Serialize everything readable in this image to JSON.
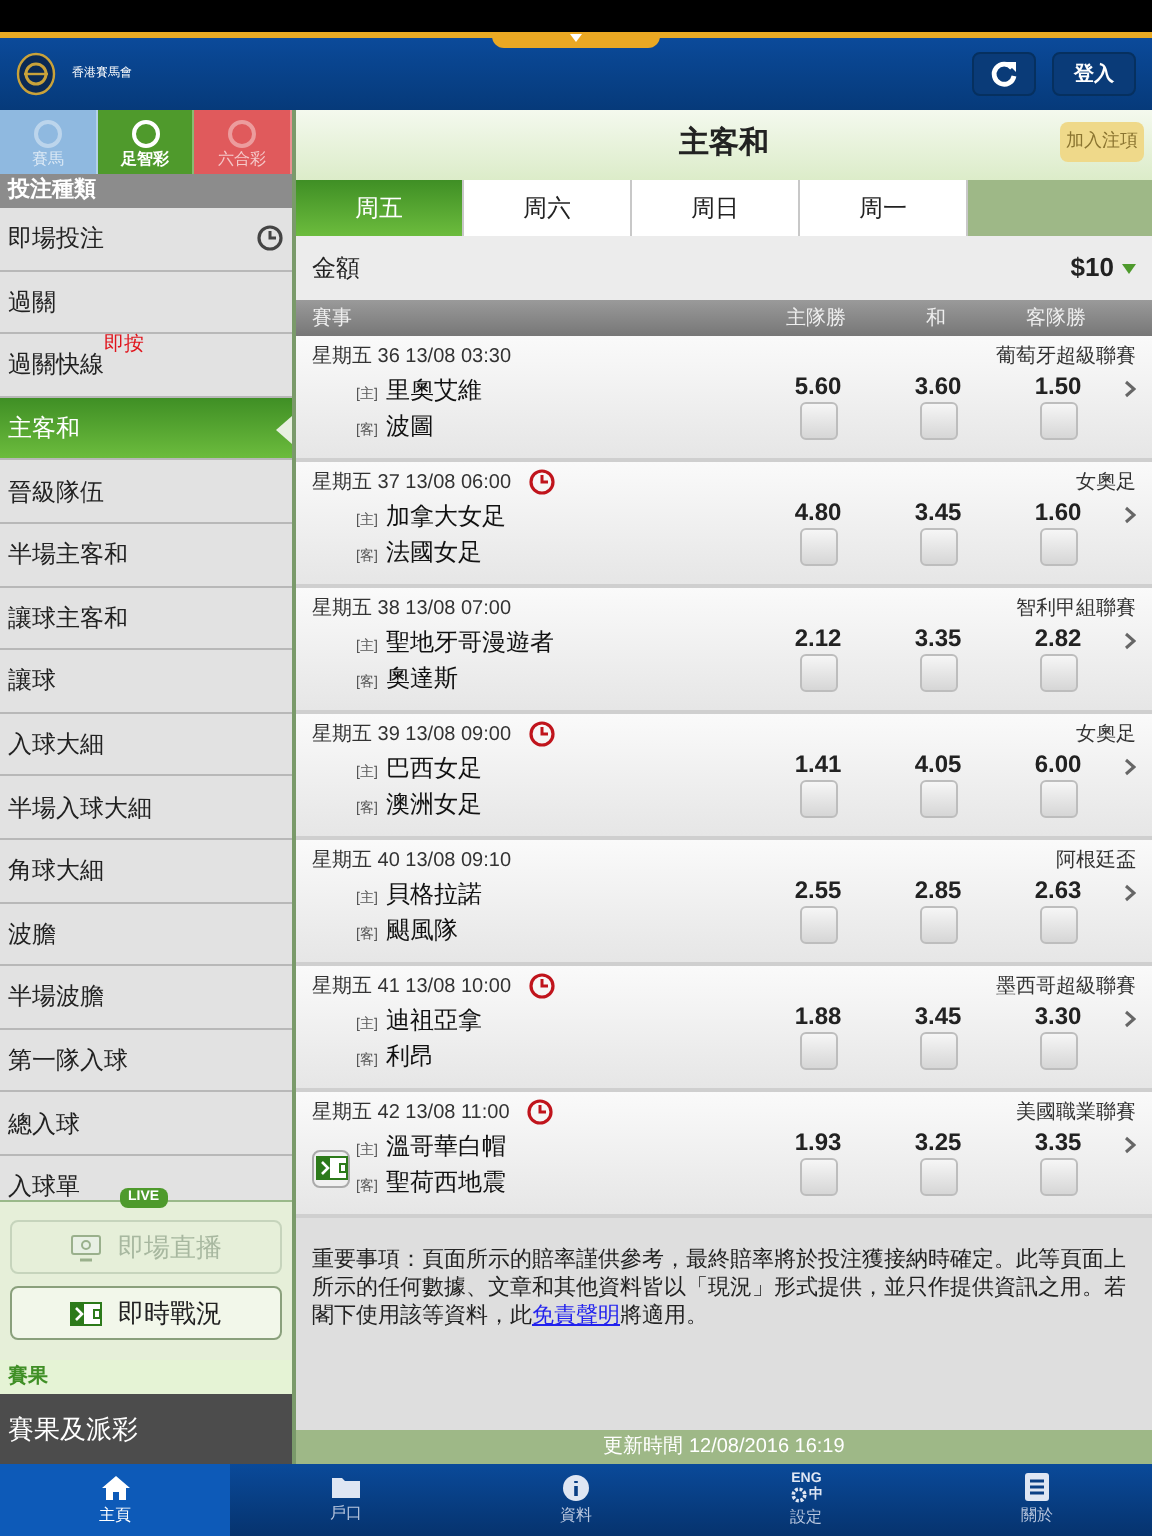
{
  "header": {
    "logo_text": "香港賽馬會",
    "login": "登入"
  },
  "sport_tabs": [
    {
      "label": "賽馬",
      "selected": false,
      "color": "#8fb9e0"
    },
    {
      "label": "足智彩",
      "selected": true,
      "color": "#4f9a2c"
    },
    {
      "label": "六合彩",
      "selected": false,
      "color": "#e05a5c"
    }
  ],
  "sidebar": {
    "heading": "投注種類",
    "items": [
      {
        "label": "即場投注",
        "selected": false,
        "kind": "clock"
      },
      {
        "label": "過關",
        "selected": false
      },
      {
        "label": "過關快線",
        "selected": false,
        "badge": "即按"
      },
      {
        "label": "主客和",
        "selected": true
      },
      {
        "label": "晉級隊伍",
        "selected": false
      },
      {
        "label": "半場主客和",
        "selected": false
      },
      {
        "label": "讓球主客和",
        "selected": false
      },
      {
        "label": "讓球",
        "selected": false
      },
      {
        "label": "入球大細",
        "selected": false
      },
      {
        "label": "半場入球大細",
        "selected": false
      },
      {
        "label": "角球大細",
        "selected": false
      },
      {
        "label": "波膽",
        "selected": false
      },
      {
        "label": "半場波膽",
        "selected": false
      },
      {
        "label": "第一隊入球",
        "selected": false
      },
      {
        "label": "總入球",
        "selected": false
      },
      {
        "label": "入球單",
        "selected": false
      }
    ],
    "live": {
      "tag": "LIVE",
      "buttons": [
        {
          "label": "即場直播",
          "disabled": true,
          "kind": "tv"
        },
        {
          "label": "即時戰況",
          "disabled": false,
          "kind": "pitch"
        }
      ]
    },
    "results_heading": "賽果",
    "results_item": "賽果及派彩"
  },
  "main": {
    "title": "主客和",
    "add_button": "加入注項",
    "day_tabs": [
      {
        "label": "周五",
        "selected": true
      },
      {
        "label": "周六",
        "selected": false
      },
      {
        "label": "周日",
        "selected": false
      },
      {
        "label": "周一",
        "selected": false
      }
    ],
    "amount_label": "金額",
    "amount_value": "$10",
    "columns": [
      "賽事",
      "主隊勝",
      "和",
      "客隊勝"
    ],
    "matches": [
      {
        "info": "星期五 36 13/08 03:30",
        "clock": false,
        "league": "葡萄牙超級聯賽",
        "home_tag": "[主]",
        "home": "里奧艾維",
        "away_tag": "[客]",
        "away": "波圖",
        "live_icon": false,
        "odds": [
          {
            "value": "5.60",
            "checked": false
          },
          {
            "value": "3.60",
            "checked": false
          },
          {
            "value": "1.50",
            "checked": false
          }
        ]
      },
      {
        "info": "星期五 37 13/08 06:00",
        "clock": true,
        "league": "女奧足",
        "home_tag": "[主]",
        "home": "加拿大女足",
        "away_tag": "[客]",
        "away": "法國女足",
        "live_icon": false,
        "odds": [
          {
            "value": "4.80",
            "checked": false
          },
          {
            "value": "3.45",
            "checked": false
          },
          {
            "value": "1.60",
            "checked": false
          }
        ]
      },
      {
        "info": "星期五 38 13/08 07:00",
        "clock": false,
        "league": "智利甲組聯賽",
        "home_tag": "[主]",
        "home": "聖地牙哥漫遊者",
        "away_tag": "[客]",
        "away": "奧達斯",
        "live_icon": false,
        "odds": [
          {
            "value": "2.12",
            "checked": false
          },
          {
            "value": "3.35",
            "checked": false
          },
          {
            "value": "2.82",
            "checked": false
          }
        ]
      },
      {
        "info": "星期五 39 13/08 09:00",
        "clock": true,
        "league": "女奧足",
        "home_tag": "[主]",
        "home": "巴西女足",
        "away_tag": "[客]",
        "away": "澳洲女足",
        "live_icon": false,
        "odds": [
          {
            "value": "1.41",
            "checked": false
          },
          {
            "value": "4.05",
            "checked": false
          },
          {
            "value": "6.00",
            "checked": false
          }
        ]
      },
      {
        "info": "星期五 40 13/08 09:10",
        "clock": false,
        "league": "阿根廷盃",
        "home_tag": "[主]",
        "home": "貝格拉諾",
        "away_tag": "[客]",
        "away": "颶風隊",
        "live_icon": false,
        "odds": [
          {
            "value": "2.55",
            "checked": false
          },
          {
            "value": "2.85",
            "checked": false
          },
          {
            "value": "2.63",
            "checked": false
          }
        ]
      },
      {
        "info": "星期五 41 13/08 10:00",
        "clock": true,
        "league": "墨西哥超級聯賽",
        "home_tag": "[主]",
        "home": "迪祖亞拿",
        "away_tag": "[客]",
        "away": "利昂",
        "live_icon": false,
        "odds": [
          {
            "value": "1.88",
            "checked": false
          },
          {
            "value": "3.45",
            "checked": false
          },
          {
            "value": "3.30",
            "checked": false
          }
        ]
      },
      {
        "info": "星期五 42 13/08 11:00",
        "clock": true,
        "league": "美國職業聯賽",
        "home_tag": "[主]",
        "home": "溫哥華白帽",
        "away_tag": "[客]",
        "away": "聖荷西地震",
        "live_icon": true,
        "odds": [
          {
            "value": "1.93",
            "checked": false
          },
          {
            "value": "3.25",
            "checked": false
          },
          {
            "value": "3.35",
            "checked": false
          }
        ]
      }
    ],
    "disclaimer_before": "重要事項：頁面所示的賠率謹供參考，最終賠率將於投注獲接納時確定。此等頁面上所示的任何數據、文章和其他資料皆以「現況」形式提供，並只作提供資訊之用。若閣下使用該等資料，此",
    "disclaimer_link": "免責聲明",
    "disclaimer_after": "將適用。",
    "updated": "更新時間 12/08/2016 16:19"
  },
  "tab_bar": [
    {
      "label": "主頁",
      "kind": "home",
      "selected": true
    },
    {
      "label": "戶口",
      "kind": "folder",
      "selected": false
    },
    {
      "label": "資料",
      "kind": "info",
      "selected": false
    },
    {
      "label": "設定",
      "kind": "settings",
      "selected": false,
      "icon_text": "ENG",
      "icon_char": "中"
    },
    {
      "label": "關於",
      "kind": "doc",
      "selected": false
    }
  ]
}
